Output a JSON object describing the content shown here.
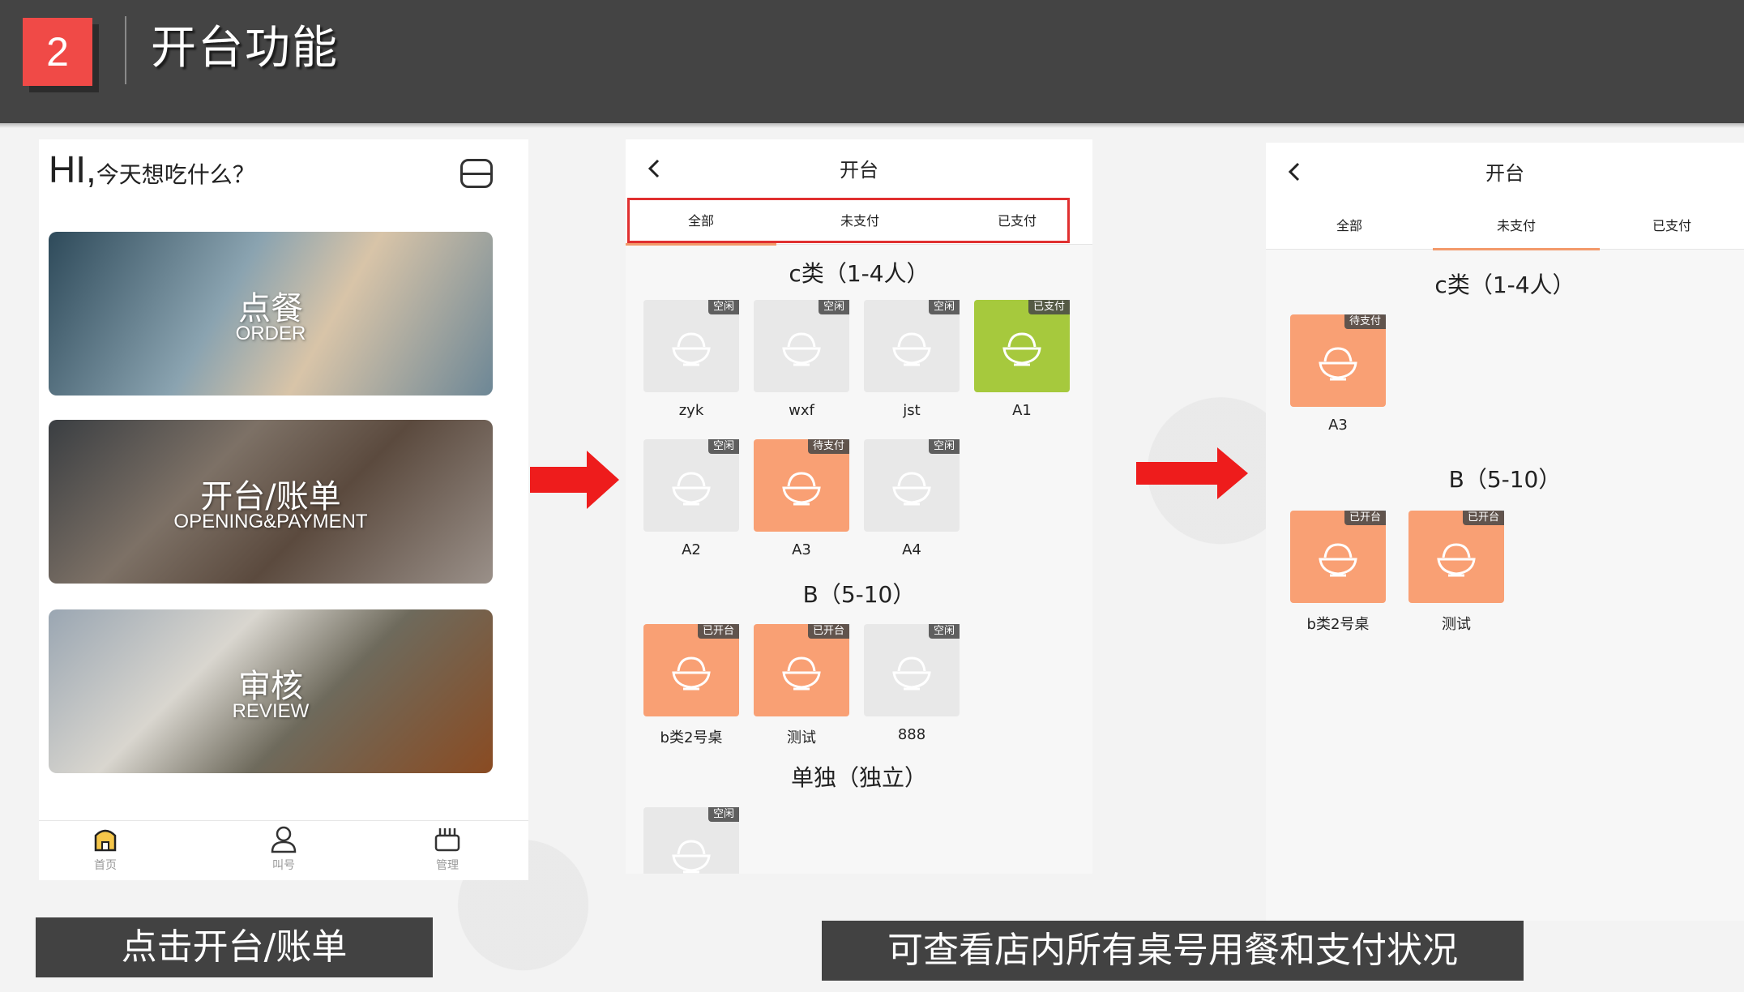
{
  "header": {
    "number": "2",
    "title": "开台功能"
  },
  "home": {
    "greeting_hi": "HI,",
    "greeting_sub": "今天想吃什么？",
    "cards": [
      {
        "title": "点餐",
        "subtitle": "ORDER"
      },
      {
        "title": "开台/账单",
        "subtitle": "OPENING&PAYMENT"
      },
      {
        "title": "审核",
        "subtitle": "REVIEW"
      }
    ],
    "tabbar": [
      {
        "label": "首页",
        "icon": "home-icon"
      },
      {
        "label": "叫号",
        "icon": "user-icon"
      },
      {
        "label": "管理",
        "icon": "manage-icon"
      }
    ]
  },
  "screen1": {
    "title": "开台",
    "tabs": [
      "全部",
      "未支付",
      "已支付"
    ],
    "active_tab": 0,
    "sections": {
      "c": "c类（1-4人）",
      "b": "B（5-10）",
      "solo": "单独（独立）"
    },
    "tables_c": [
      {
        "name": "zyk",
        "status": "空闲",
        "color": "#e8e8e8"
      },
      {
        "name": "wxf",
        "status": "空闲",
        "color": "#e8e8e8"
      },
      {
        "name": "jst",
        "status": "空闲",
        "color": "#e8e8e8"
      },
      {
        "name": "A1",
        "status": "已支付",
        "color": "#a6c93d"
      },
      {
        "name": "A2",
        "status": "空闲",
        "color": "#e8e8e8"
      },
      {
        "name": "A3",
        "status": "待支付",
        "color": "#f9a074"
      },
      {
        "name": "A4",
        "status": "空闲",
        "color": "#e8e8e8"
      }
    ],
    "tables_b": [
      {
        "name": "b类2号桌",
        "status": "已开台",
        "color": "#f9a074"
      },
      {
        "name": "测试",
        "status": "已开台",
        "color": "#f9a074"
      },
      {
        "name": "888",
        "status": "空闲",
        "color": "#e8e8e8"
      }
    ],
    "tables_solo": [
      {
        "name": "",
        "status": "空闲",
        "color": "#e8e8e8"
      }
    ]
  },
  "screen2": {
    "title": "开台",
    "tabs": [
      "全部",
      "未支付",
      "已支付"
    ],
    "active_tab": 1,
    "sections": {
      "c": "c类（1-4人）",
      "b": "B（5-10）"
    },
    "tables_c": [
      {
        "name": "A3",
        "status": "待支付",
        "color": "#f9a074"
      }
    ],
    "tables_b": [
      {
        "name": "b类2号桌",
        "status": "已开台",
        "color": "#f9a074"
      },
      {
        "name": "测试",
        "status": "已开台",
        "color": "#f9a074"
      }
    ]
  },
  "captions": {
    "left": "点击开台/账单",
    "right": "可查看店内所有桌号用餐和支付状况"
  },
  "colors": {
    "accent": "#f04a47",
    "arrow": "#ee1c1c",
    "free": "#e8e8e8",
    "pending": "#f9a074",
    "paid": "#a6c93d"
  }
}
